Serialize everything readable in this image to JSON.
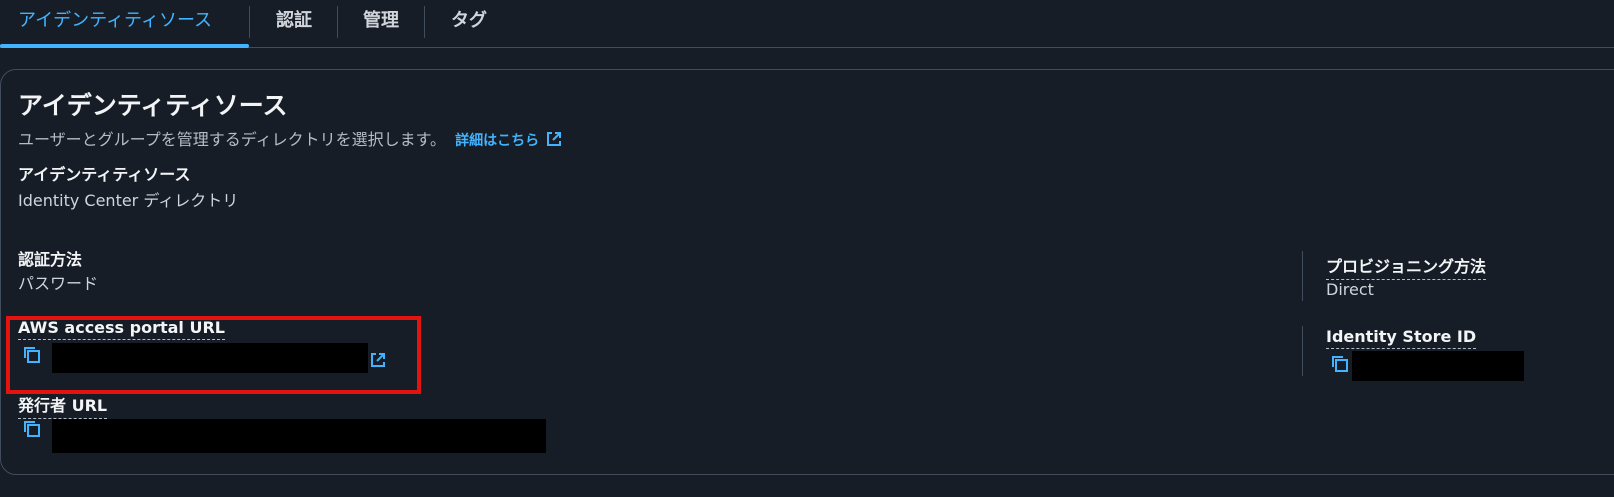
{
  "tabs": [
    {
      "label": "アイデンティティソース",
      "active": true
    },
    {
      "label": "認証",
      "active": false
    },
    {
      "label": "管理",
      "active": false
    },
    {
      "label": "タグ",
      "active": false
    }
  ],
  "section": {
    "title": "アイデンティティソース",
    "description": "ユーザーとグループを管理するディレクトリを選択します。",
    "learn_more": "詳細はこちら"
  },
  "fields": {
    "identity_source": {
      "label": "アイデンティティソース",
      "value": "Identity Center ディレクトリ"
    },
    "auth_method": {
      "label": "認証方法",
      "value": "パスワード"
    },
    "portal_url": {
      "label": "AWS access portal URL"
    },
    "issuer_url": {
      "label": "発行者 URL"
    },
    "provisioning": {
      "label": "プロビジョニング方法",
      "value": "Direct"
    },
    "identity_store_id": {
      "label": "Identity Store ID"
    }
  },
  "icons": {
    "copy": "copy-icon",
    "external": "external-link-icon"
  },
  "colors": {
    "accent": "#42b4ff",
    "background": "#161d26",
    "highlight": "#e3140f"
  }
}
